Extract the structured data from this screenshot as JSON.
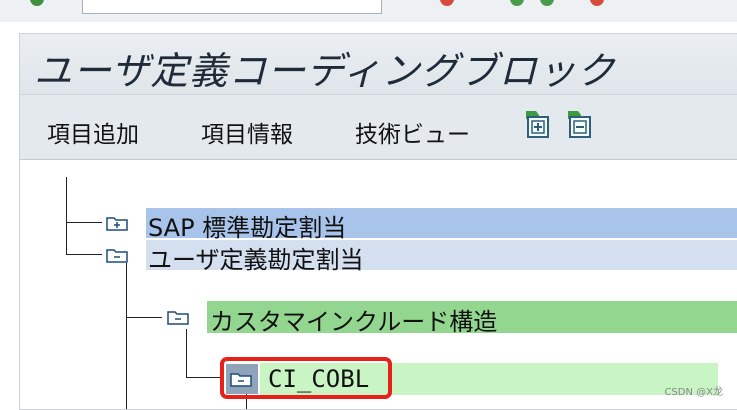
{
  "title": "ユーザ定義コーディングブロック",
  "toolbar": {
    "add_item": "項目追加",
    "item_info": "項目情報",
    "tech_view": "技術ビュー"
  },
  "tree": {
    "node_sap_standard": "SAP 標準勘定割当",
    "node_user_defined": "ユーザ定義勘定割当",
    "node_custom_include": "カスタマインクルード構造",
    "node_ci_cobl": "CI_COBL"
  },
  "watermark": "CSDN @X龙",
  "colors": {
    "row_blue": "#a9c4ea",
    "row_blue_light": "#d4dff0",
    "row_green": "#93d68f",
    "row_green_light": "#c8f5c3",
    "highlight_red": "#e8201a"
  },
  "icons": [
    "expand-all-icon",
    "collapse-all-icon",
    "folder-open-icon"
  ]
}
